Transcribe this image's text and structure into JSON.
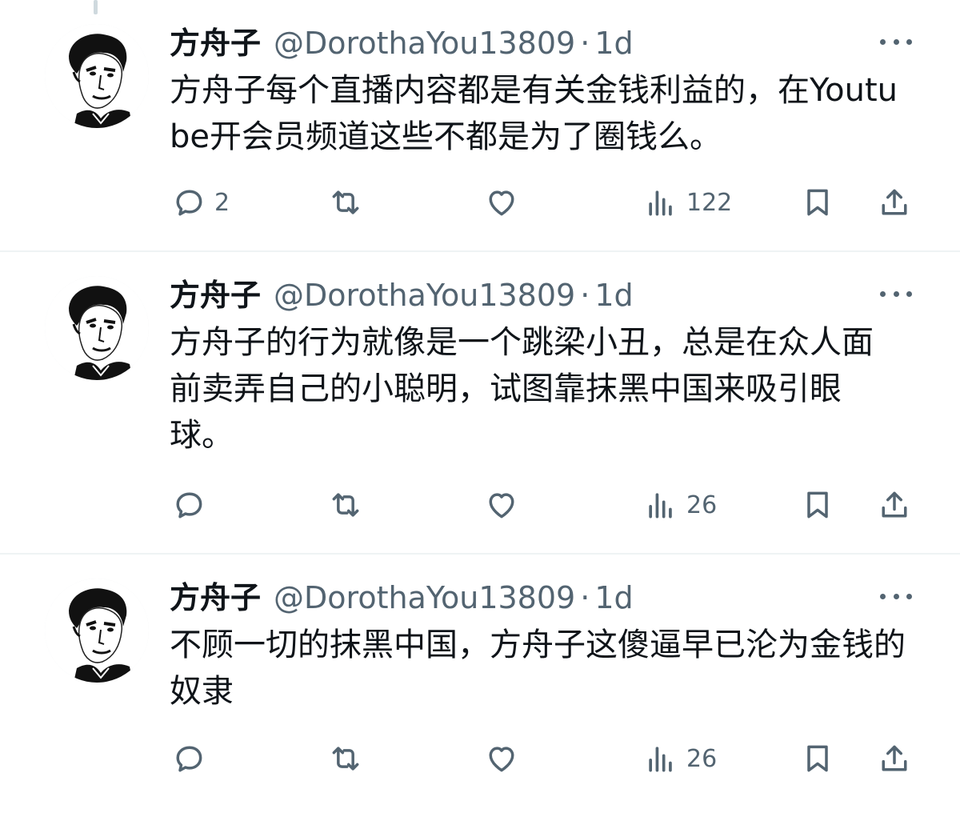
{
  "tweets": [
    {
      "name": "方舟子",
      "handle": "@DorothaYou13809",
      "separator": "·",
      "time": "1d",
      "text": "方舟子每个直播内容都是有关金钱利益的，在Youtube开会员频道这些不都是为了圈钱么。",
      "replies": "2",
      "retweets": "",
      "likes": "",
      "views": "122"
    },
    {
      "name": "方舟子",
      "handle": "@DorothaYou13809",
      "separator": "·",
      "time": "1d",
      "text": "方舟子的行为就像是一个跳梁小丑，总是在众人面前卖弄自己的小聪明，试图靠抹黑中国来吸引眼球。",
      "replies": "",
      "retweets": "",
      "likes": "",
      "views": "26"
    },
    {
      "name": "方舟子",
      "handle": "@DorothaYou13809",
      "separator": "·",
      "time": "1d",
      "text": "不顾一切的抹黑中国，方舟子这傻逼早已沦为金钱的奴隶",
      "replies": "",
      "retweets": "",
      "likes": "",
      "views": "26"
    }
  ],
  "icons": {
    "reply": "reply-icon",
    "retweet": "retweet-icon",
    "like": "heart-icon",
    "views": "views-chart-icon",
    "bookmark": "bookmark-icon",
    "share": "share-icon",
    "more": "more-horizontal-icon"
  },
  "colors": {
    "text": "#0f1419",
    "secondary": "#536471",
    "divider": "#eff3f4"
  }
}
